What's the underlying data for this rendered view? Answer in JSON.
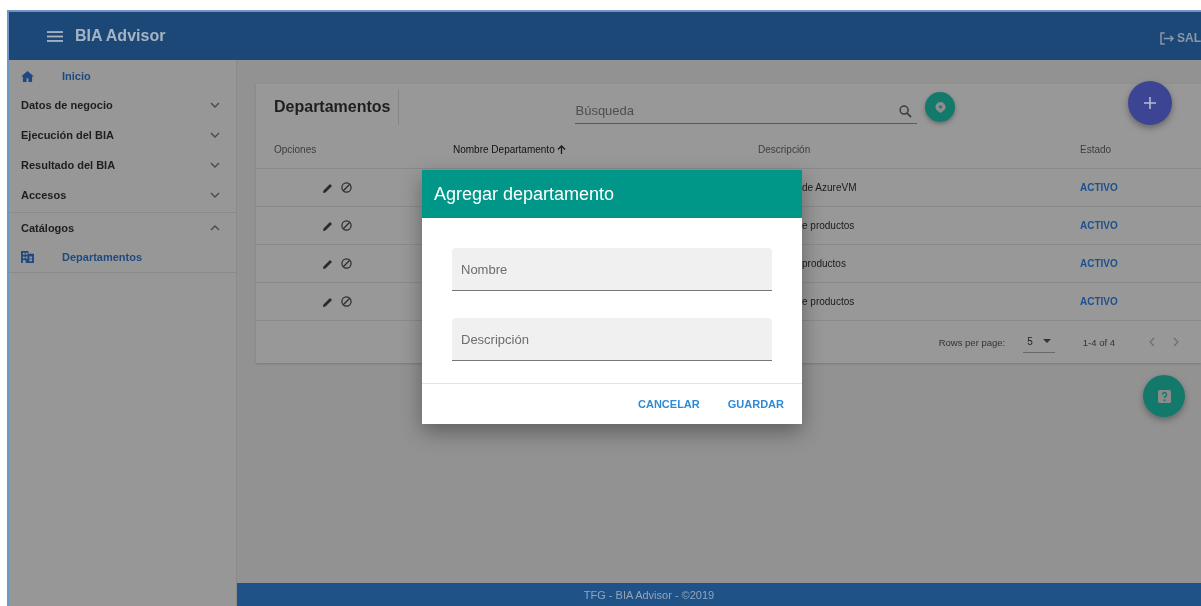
{
  "app_bar": {
    "title": "BIA Advisor",
    "logout_label": "SAL"
  },
  "sidebar": {
    "home": {
      "label": "Inicio"
    },
    "groups": [
      {
        "label": "Datos de negocio",
        "expanded": false
      },
      {
        "label": "Ejecución del BIA",
        "expanded": false
      },
      {
        "label": "Resultado del BIA",
        "expanded": false
      },
      {
        "label": "Accesos",
        "expanded": false
      },
      {
        "label": "Catálogos",
        "expanded": true,
        "children": [
          {
            "label": "Departamentos"
          }
        ]
      }
    ]
  },
  "table": {
    "title": "Departamentos",
    "search": {
      "placeholder": "Búsqueda"
    },
    "columns": [
      {
        "label": "Opciones",
        "sorted": false
      },
      {
        "label": "Nombre Departamento",
        "sorted": true
      },
      {
        "label": "Descripción",
        "sorted": false
      },
      {
        "label": "Estado",
        "sorted": false
      }
    ],
    "rows": [
      {
        "description": "de AzureVM",
        "status": "ACTIVO"
      },
      {
        "description": "e productos",
        "status": "ACTIVO"
      },
      {
        "description": "productos",
        "status": "ACTIVO"
      },
      {
        "description": "e productos",
        "status": "ACTIVO"
      }
    ],
    "rows_per_page_label": "Rows per page:",
    "rows_per_page": "5",
    "range": "1-4 of 4"
  },
  "dialog": {
    "title": "Agregar departamento",
    "fields": [
      {
        "placeholder": "Nombre"
      },
      {
        "placeholder": "Descripción"
      }
    ],
    "buttons": [
      "CANCELAR",
      "GUARDAR"
    ]
  },
  "footer": {
    "text": "TFG - BIA Advisor - ©2019"
  }
}
